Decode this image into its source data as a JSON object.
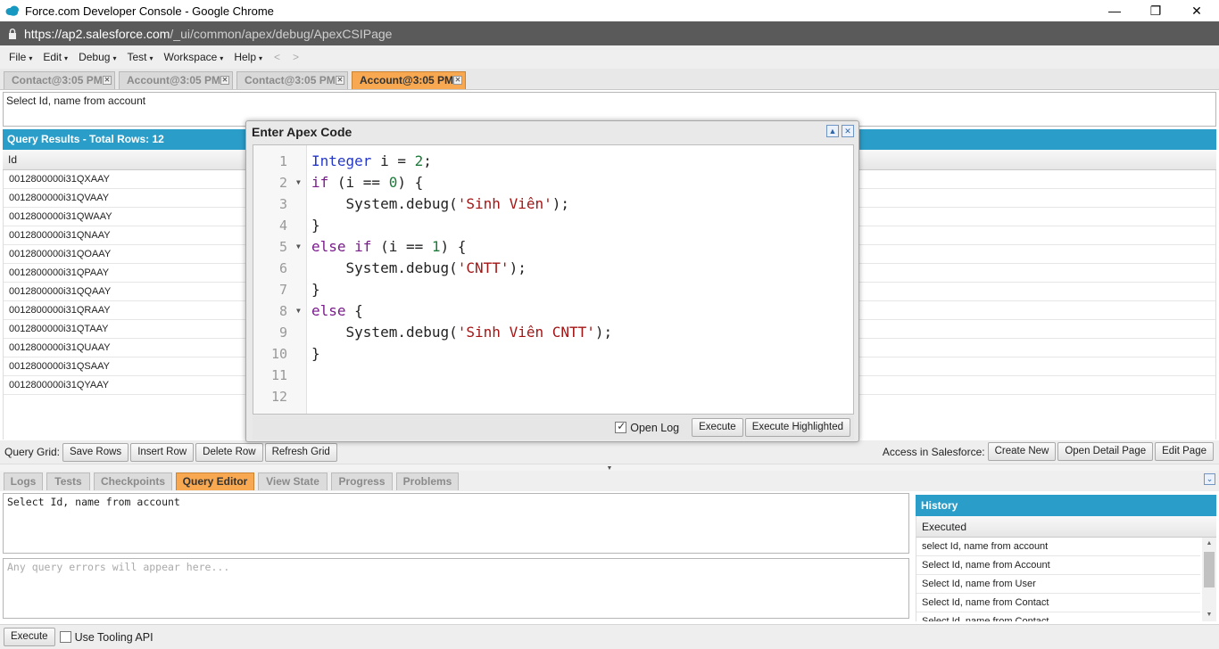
{
  "window": {
    "title": "Force.com Developer Console - Google Chrome",
    "url_host": "https://ap2.salesforce.com",
    "url_path": "/_ui/common/apex/debug/ApexCSIPage"
  },
  "menu": [
    "File",
    "Edit",
    "Debug",
    "Test",
    "Workspace",
    "Help"
  ],
  "nav": {
    "back": "<",
    "forward": ">"
  },
  "file_tabs": [
    "Contact@3:05 PM",
    "Account@3:05 PM",
    "Contact@3:05 PM",
    "Account@3:05 PM"
  ],
  "query_text": "Select Id, name from account",
  "results": {
    "header": "Query Results - Total Rows: 12",
    "column": "Id",
    "rows": [
      "0012800000i31QXAAY",
      "0012800000i31QVAAY",
      "0012800000i31QWAAY",
      "0012800000i31QNAAY",
      "0012800000i31QOAAY",
      "0012800000i31QPAAY",
      "0012800000i31QQAAY",
      "0012800000i31QRAAY",
      "0012800000i31QTAAY",
      "0012800000i31QUAAY",
      "0012800000i31QSAAY",
      "0012800000i31QYAAY"
    ]
  },
  "grid_toolbar": {
    "label": "Query Grid:",
    "buttons": [
      "Save Rows",
      "Insert Row",
      "Delete Row",
      "Refresh Grid"
    ],
    "access_label": "Access in Salesforce:",
    "access_buttons": [
      "Create New",
      "Open Detail Page",
      "Edit Page"
    ]
  },
  "bottom_tabs": [
    "Logs",
    "Tests",
    "Checkpoints",
    "Query Editor",
    "View State",
    "Progress",
    "Problems"
  ],
  "query_editor": {
    "text": "Select Id, name from account",
    "errors_placeholder": "Any query errors will appear here..."
  },
  "history": {
    "header": "History",
    "column": "Executed",
    "rows": [
      "select Id, name from account",
      "Select Id, name from Account",
      "Select Id, name from User",
      "Select Id, name from Contact",
      "Select Id, name from Contact"
    ]
  },
  "bottom_bar": {
    "execute": "Execute",
    "tooling": "Use Tooling API"
  },
  "modal": {
    "title": "Enter Apex Code",
    "line_numbers": [
      "1",
      "2",
      "3",
      "4",
      "5",
      "6",
      "7",
      "8",
      "9",
      "10",
      "11",
      "12"
    ],
    "code": {
      "l1_type": "Integer",
      "l1_rest": " i = ",
      "l1_num": "2",
      "l1_end": ";",
      "l2_kw": "if",
      "l2_a": " (i == ",
      "l2_num": "0",
      "l2_b": ") {",
      "l3_pre": "    System.debug(",
      "l3_str": "'Sinh Viên'",
      "l3_end": ");",
      "l4": "}",
      "l5_kw": "else if",
      "l5_a": " (i == ",
      "l5_num": "1",
      "l5_b": ") {",
      "l6_pre": "    System.debug(",
      "l6_str": "'CNTT'",
      "l6_end": ");",
      "l7": "}",
      "l8_kw": "else",
      "l8_b": " {",
      "l9_pre": "    System.debug(",
      "l9_str": "'Sinh Viên CNTT'",
      "l9_end": ");",
      "l10": "}"
    },
    "open_log": "Open Log",
    "execute": "Execute",
    "execute_highlighted": "Execute Highlighted"
  }
}
